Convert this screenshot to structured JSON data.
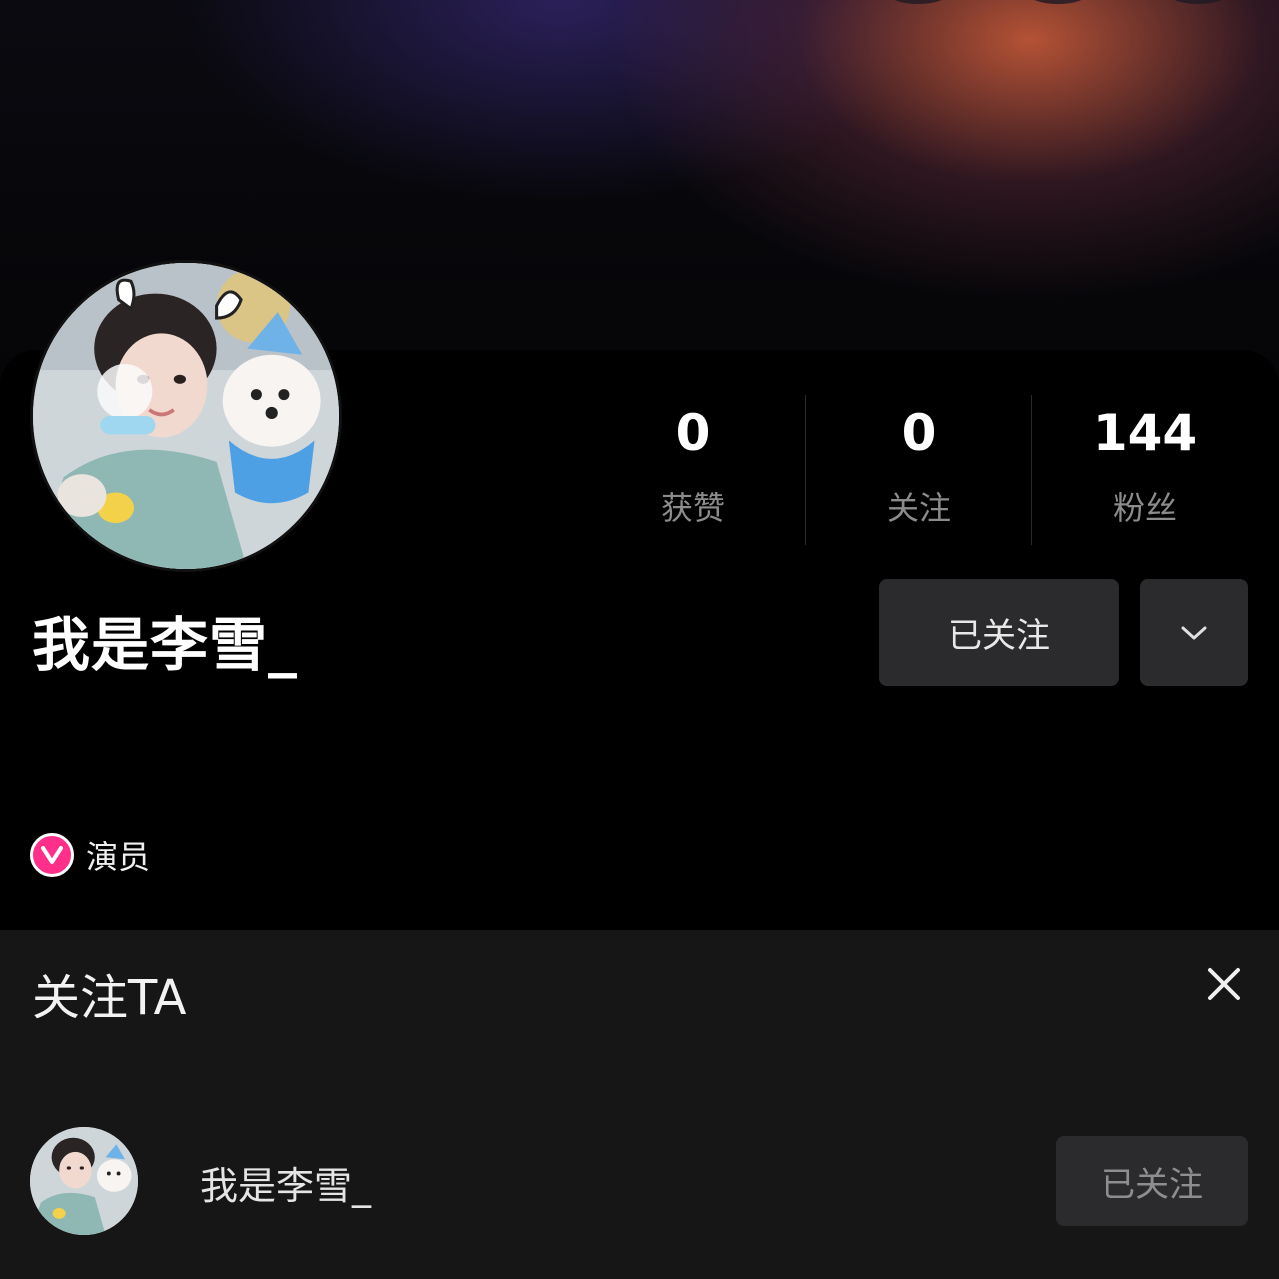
{
  "profile": {
    "username": "我是李雪_",
    "stats": [
      {
        "value": "0",
        "label": "获赞"
      },
      {
        "value": "0",
        "label": "关注"
      },
      {
        "value": "144",
        "label": "粉丝"
      }
    ],
    "follow_button_label": "已关注",
    "more_icon": "chevron-down-icon",
    "verification": {
      "icon": "verified-v-icon",
      "label": "演员",
      "color": "#ff2f8a"
    }
  },
  "follow_sheet": {
    "title": "关注TA",
    "close_icon": "close-icon",
    "user_name": "我是李雪_",
    "button_label": "已关注"
  },
  "colors": {
    "background": "#000000",
    "sheet": "#161617",
    "button": "#2b2b2d",
    "muted_text": "#8c8c8c"
  }
}
